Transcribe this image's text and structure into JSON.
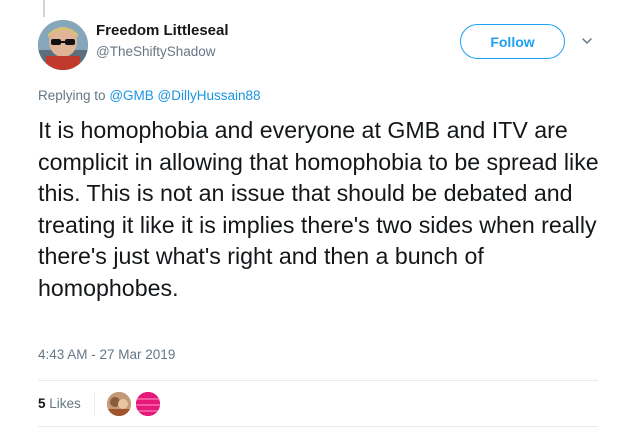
{
  "user": {
    "display_name": "Freedom Littleseal",
    "handle": "@TheShiftyShadow"
  },
  "follow_button": {
    "label": "Follow"
  },
  "reply_context": {
    "prefix": "Replying to",
    "mentions": [
      "@GMB",
      "@DillyHussain88"
    ]
  },
  "tweet": {
    "text": "It is homophobia and everyone at GMB and ITV are complicit in allowing that homophobia to be spread like this. This is not an issue that should be debated and treating it like it is implies there's two sides when really there's just what's right and then a bunch of homophobes.",
    "timestamp": "4:43 AM - 27 Mar 2019"
  },
  "stats": {
    "likes_count": "5",
    "likes_label": "Likes"
  },
  "colors": {
    "accent": "#1da1f2",
    "mention": "#1b95e0",
    "secondary_text": "#657786",
    "divider": "#e6ecf0"
  }
}
